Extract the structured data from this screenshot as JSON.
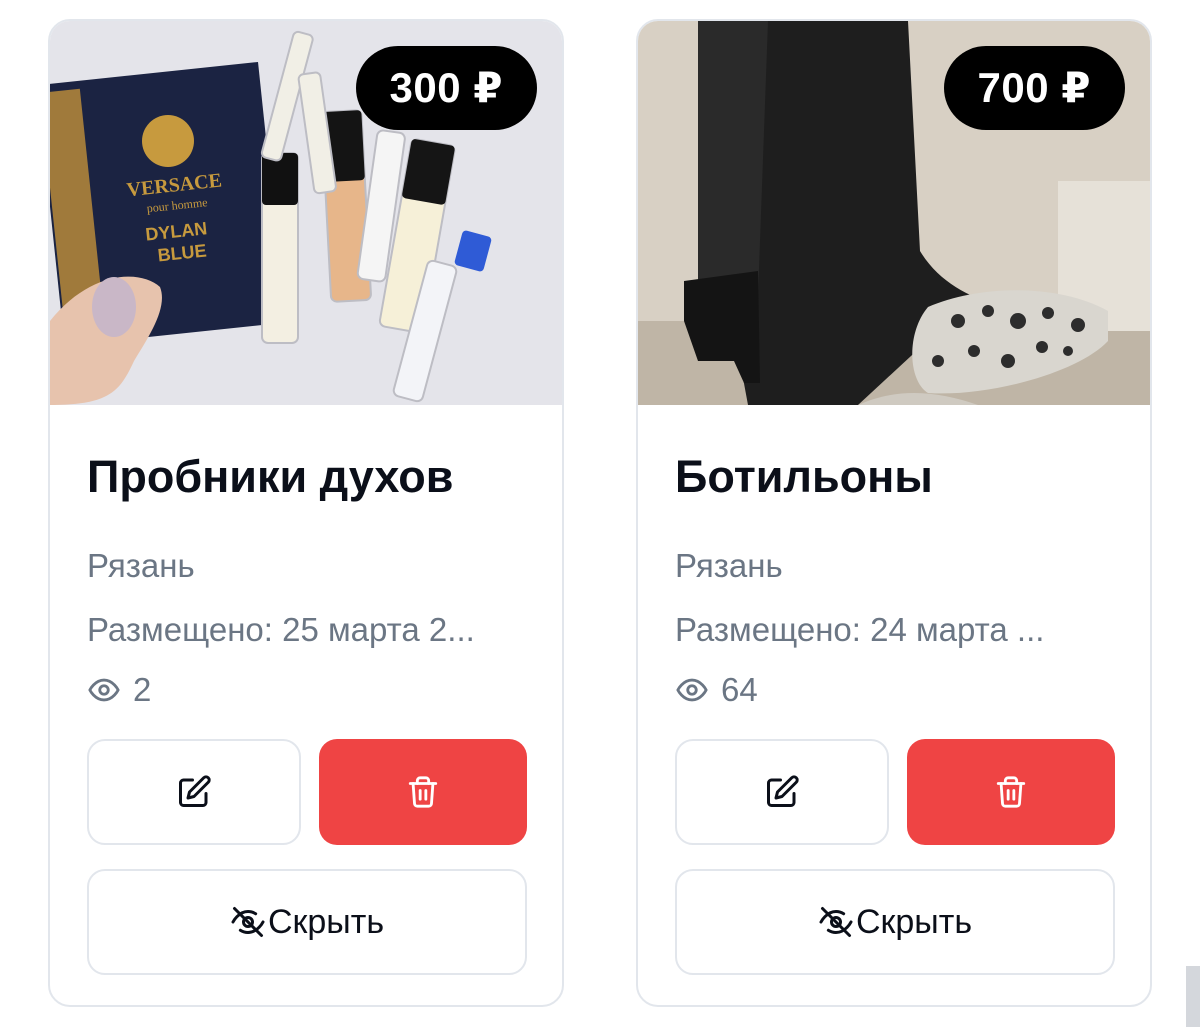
{
  "listings": [
    {
      "price": "300 ₽",
      "title": "Пробники духов",
      "city": "Рязань",
      "posted": "Размещено: 25 марта 2...",
      "views": "2",
      "hide_label": "Скрыть",
      "photo_icon": "perfume-samples-photo",
      "photo_text": [
        "VERSACE",
        "pour homme",
        "DYLAN",
        "BLUE"
      ]
    },
    {
      "price": "700 ₽",
      "title": "Ботильоны",
      "city": "Рязань",
      "posted": "Размещено: 24 марта ...",
      "views": "64",
      "hide_label": "Скрыть",
      "photo_icon": "ankle-boots-photo"
    }
  ],
  "icons": {
    "edit": "edit-icon",
    "delete": "trash-icon",
    "views": "eye-icon",
    "hide": "eye-off-icon"
  },
  "colors": {
    "price_badge_bg": "#000000",
    "delete_button_bg": "#ef4444",
    "secondary_text": "#6b7684",
    "border": "#e2e6ec"
  }
}
